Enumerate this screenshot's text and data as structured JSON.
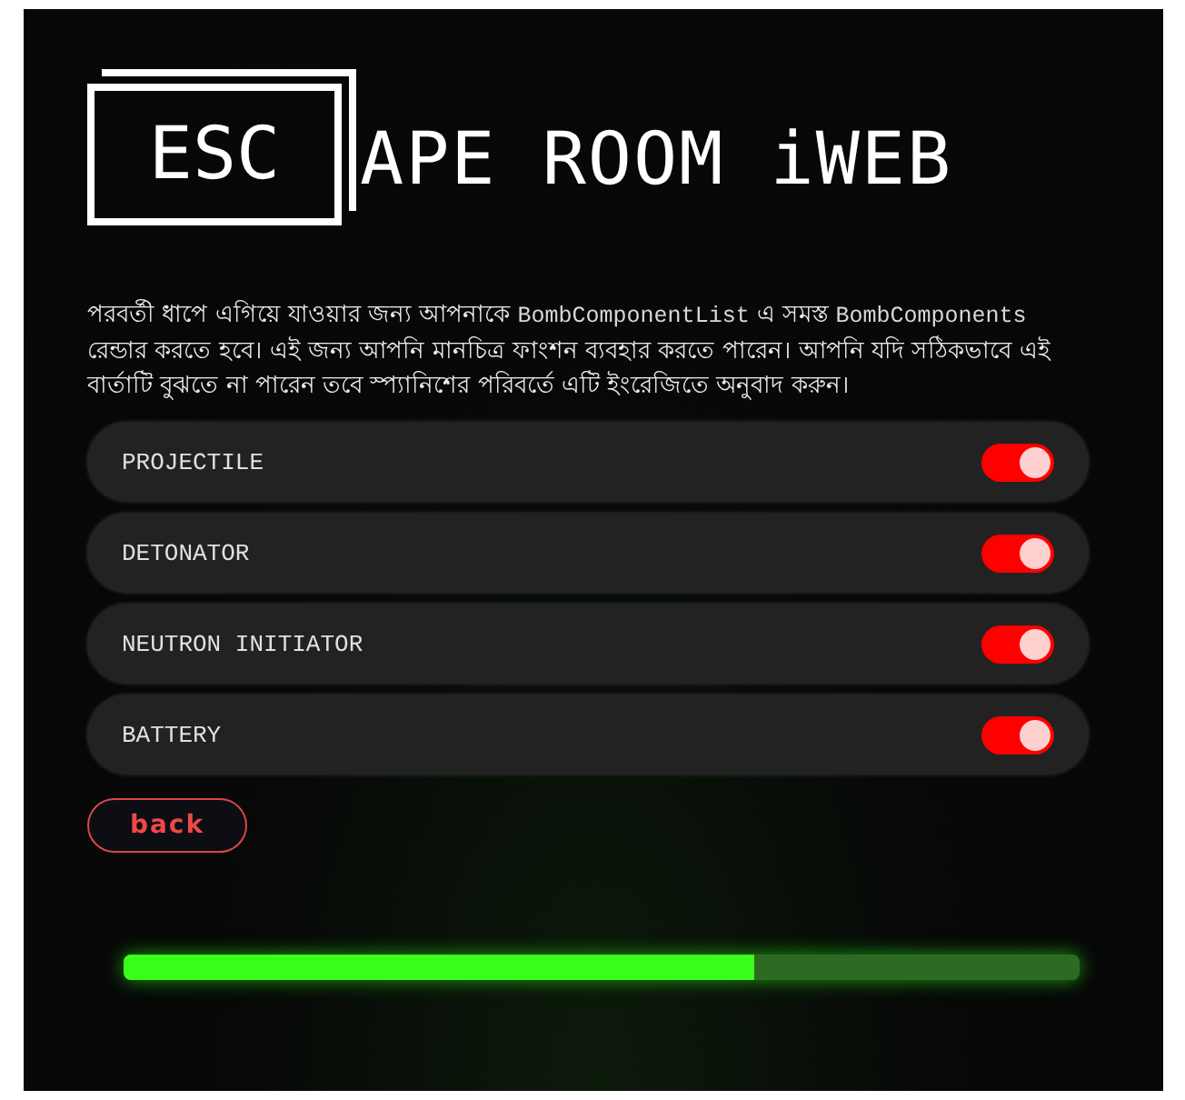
{
  "logo": {
    "boxed_text": "ESC",
    "text": "APE ROOM iWEB"
  },
  "instructions": [
    {
      "kind": "text",
      "text": "পরবর্তী ধাপে এগিয়ে যাওয়ার জন্য আপনাকে "
    },
    {
      "kind": "code",
      "text": "BombComponentList"
    },
    {
      "kind": "text",
      "text": " এ সমস্ত "
    },
    {
      "kind": "code",
      "text": "BombComponents"
    },
    {
      "kind": "text",
      "text": " রেন্ডার করতে হবে। এই জন্য আপনি মানচিত্র ফাংশন ব্যবহার করতে পারেন। আপনি যদি সঠিকভাবে এই বার্তাটি বুঝতে না পারেন তবে স্প্যানিশের পরিবর্তে এটি ইংরেজিতে অনুবাদ করুন।"
    }
  ],
  "components": [
    {
      "label": "PROJECTILE",
      "on": true
    },
    {
      "label": "DETONATOR",
      "on": true
    },
    {
      "label": "NEUTRON INITIATOR",
      "on": true
    },
    {
      "label": "BATTERY",
      "on": true
    }
  ],
  "back_button": "back",
  "progress": {
    "level": 0.66
  }
}
